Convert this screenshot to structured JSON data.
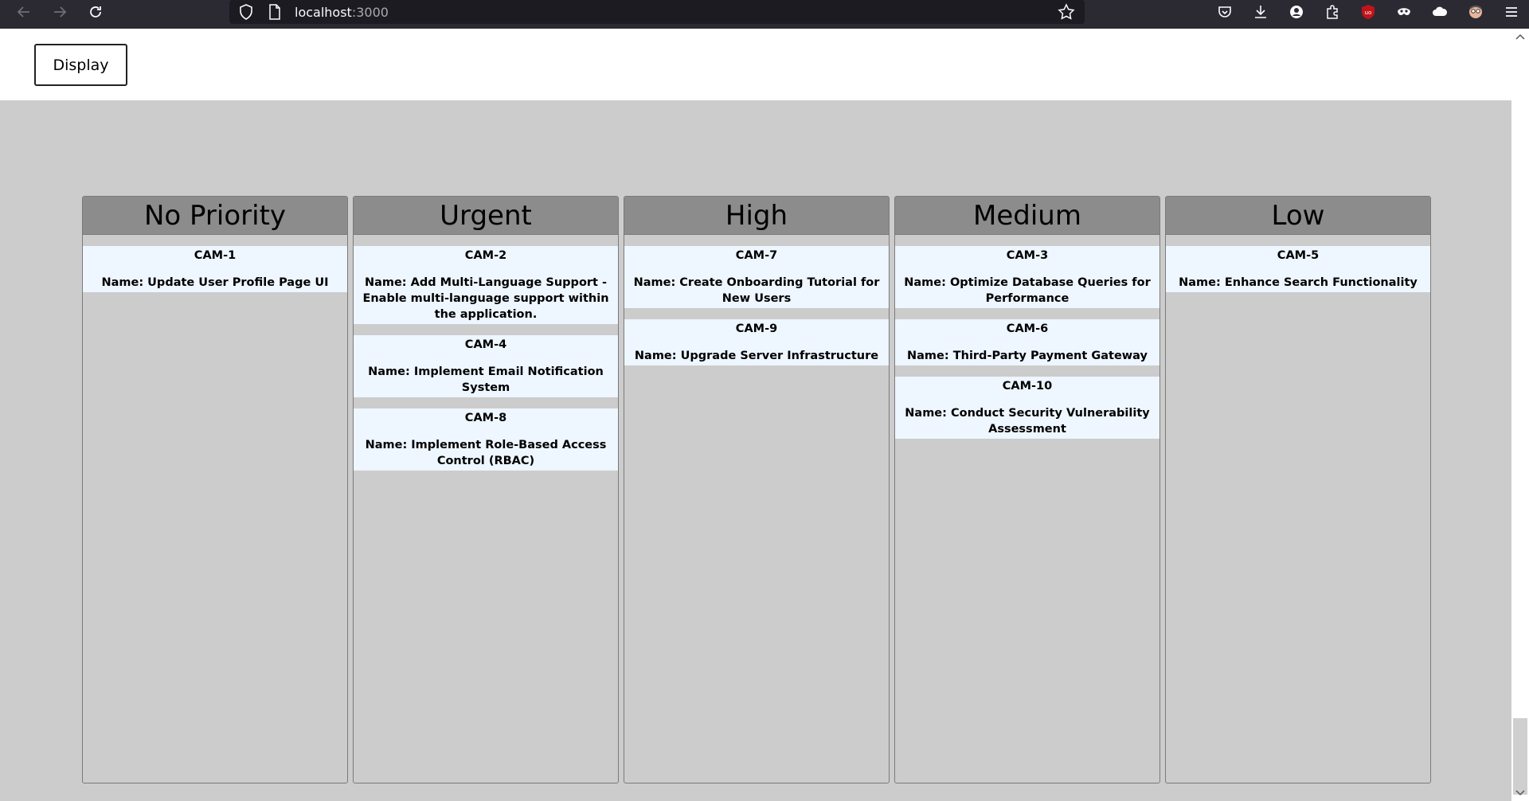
{
  "browser": {
    "url_host": "localhost",
    "url_port": ":3000"
  },
  "header": {
    "display_label": "Display"
  },
  "columns": [
    {
      "title": "No Priority",
      "cards": [
        {
          "id": "CAM-1",
          "name": "Name: Update User Profile Page UI"
        }
      ]
    },
    {
      "title": "Urgent",
      "cards": [
        {
          "id": "CAM-2",
          "name": "Name: Add Multi-Language Support - Enable multi-language support within the application."
        },
        {
          "id": "CAM-4",
          "name": "Name: Implement Email Notification System"
        },
        {
          "id": "CAM-8",
          "name": "Name: Implement Role-Based Access Control (RBAC)"
        }
      ]
    },
    {
      "title": "High",
      "cards": [
        {
          "id": "CAM-7",
          "name": "Name: Create Onboarding Tutorial for New Users"
        },
        {
          "id": "CAM-9",
          "name": "Name: Upgrade Server Infrastructure"
        }
      ]
    },
    {
      "title": "Medium",
      "cards": [
        {
          "id": "CAM-3",
          "name": "Name: Optimize Database Queries for Performance"
        },
        {
          "id": "CAM-6",
          "name": "Name: Third-Party Payment Gateway"
        },
        {
          "id": "CAM-10",
          "name": "Name: Conduct Security Vulnerability Assessment"
        }
      ]
    },
    {
      "title": "Low",
      "cards": [
        {
          "id": "CAM-5",
          "name": "Name: Enhance Search Functionality"
        }
      ]
    }
  ]
}
